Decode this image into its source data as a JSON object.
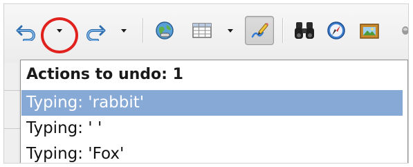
{
  "toolbar": {
    "buttons": [
      {
        "name": "undo-icon",
        "label": "Undo"
      },
      {
        "name": "redo-icon",
        "label": "Redo"
      },
      {
        "name": "hyperlink-icon",
        "label": "Hyperlink"
      },
      {
        "name": "table-icon",
        "label": "Table"
      },
      {
        "name": "draw-functions-icon",
        "label": "Show Draw Functions"
      },
      {
        "name": "find-replace-icon",
        "label": "Find & Replace"
      },
      {
        "name": "navigator-icon",
        "label": "Navigator"
      },
      {
        "name": "gallery-icon",
        "label": "Gallery"
      }
    ],
    "colors": {
      "highlight_ring": "#e0211d",
      "selection": "#87a9d6"
    }
  },
  "undo_menu": {
    "header": "Actions to undo: 1",
    "items": [
      {
        "label": "Typing: 'rabbit'",
        "selected": true
      },
      {
        "label": "Typing: ' '",
        "selected": false
      },
      {
        "label": "Typing: 'Fox'",
        "selected": false
      }
    ]
  }
}
